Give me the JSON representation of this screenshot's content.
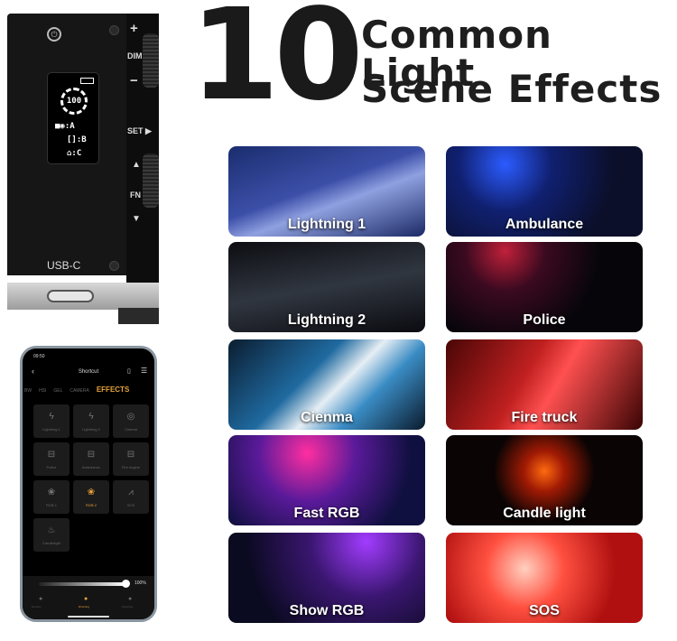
{
  "headline": {
    "number": "10",
    "line1": "Common Light",
    "line2": "Scene Effects"
  },
  "device": {
    "buttons": {
      "plus": "+",
      "dim": "DIM",
      "minus": "−",
      "set": "SET ▶",
      "up": "▲",
      "fn": "FN",
      "down": "▼"
    },
    "port_label": "USB-C",
    "display": {
      "level": "100",
      "row_a": "A",
      "row_b": "B",
      "row_c": "C"
    }
  },
  "phone": {
    "time": "09:50",
    "title": "Shortcut",
    "tabs": [
      "BW",
      "HSI",
      "GEL",
      "CAMERA",
      "EFFECTS"
    ],
    "active_tab": "EFFECTS",
    "effects": [
      "Lightning 1",
      "Lightning 2",
      "Cinema",
      "Police",
      "Ambulance",
      "Fire engine",
      "RGB 1",
      "RGB 2",
      "SOS",
      "Candlelight"
    ],
    "selected_effect": "RGB 2",
    "brightness_percent": 100,
    "brightness_label": "100%",
    "nav": [
      "Devices",
      "Dimming",
      "Favorites"
    ],
    "active_nav": "Dimming",
    "accent": "#e8a33a"
  },
  "tiles": [
    {
      "label": "Lightning 1",
      "bg": "linear-gradient(160deg,#1a2d6e,#3c4fa8 45%,#8fa0e0 60%,#1b2a66)"
    },
    {
      "label": "Ambulance",
      "bg": "radial-gradient(circle at 30% 20%,#2c5cff 0,#102070 30%,#0b0f2a 70%),#0b0f2a"
    },
    {
      "label": "Lightning 2",
      "bg": "linear-gradient(170deg,#0d0d12,#303640 50%,#0b0b10)"
    },
    {
      "label": "Police",
      "bg": "radial-gradient(circle at 30% 10%,#c0203a 0,#3b0a20 25%,#05050a 60%)"
    },
    {
      "label": "Cienma",
      "bg": "linear-gradient(135deg,#0b1d30,#1f6aa0 40%,#e6eef4 55%,#3a8cc4 70%,#0a1a2c)"
    },
    {
      "label": "Fire truck",
      "bg": "linear-gradient(120deg,#4a0606,#c02020 40%,#ff5050 55%,#3a0404)"
    },
    {
      "label": "Fast RGB",
      "bg": "radial-gradient(circle at 40% 20%,#ff2ea0 0,#5a1a9a 35%,#101040 75%)"
    },
    {
      "label": "Candle light",
      "bg": "radial-gradient(circle at 50% 40%,#ff6a10 0,#a01a04 18%,#0a0404 45%)"
    },
    {
      "label": "Show RGB",
      "bg": "radial-gradient(circle at 70% 10%,#a23cff 0,#3a1670 35%,#0a0a20 75%)"
    },
    {
      "label": "SOS",
      "bg": "radial-gradient(circle at 40% 40%,#ffd0c0 0,#ff5040 30%,#b01010 70%)"
    }
  ]
}
